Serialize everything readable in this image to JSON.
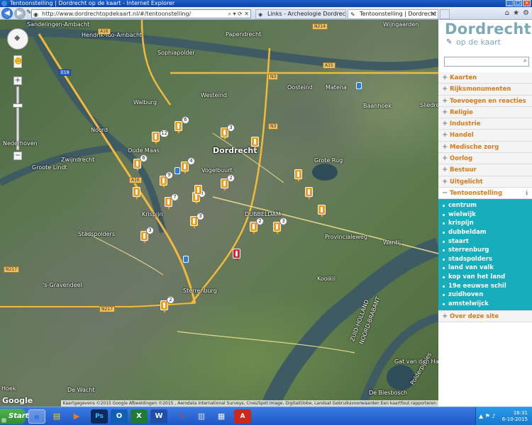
{
  "window": {
    "title": "Tentoonstelling | Dordrecht op de kaart - Internet Explorer"
  },
  "browser": {
    "url": "http://www.dordrechtopdekaart.nl/#/tentoonstelling/",
    "tabs": [
      {
        "label": "Links - Archeologie Dordrecht",
        "active": false
      },
      {
        "label": "Tentoonstelling | Dordrecht ...",
        "active": true
      }
    ]
  },
  "map": {
    "places": [
      {
        "label": "Sandelingen-Ambacht"
      },
      {
        "label": "Hendrik-Ido-Ambacht"
      },
      {
        "label": "Papendrecht"
      },
      {
        "label": "Sophiapolder"
      },
      {
        "label": "Walburg"
      },
      {
        "label": "Westeind"
      },
      {
        "label": "Oosteind"
      },
      {
        "label": "Matena"
      },
      {
        "label": "Baanhoek"
      },
      {
        "label": "Sliedrecht"
      },
      {
        "label": "Wijngaarden"
      },
      {
        "label": "Noord"
      },
      {
        "label": "Nederhoven"
      },
      {
        "label": "Zwijndrecht"
      },
      {
        "label": "Groote Lindt"
      },
      {
        "label": "Dordrecht"
      },
      {
        "label": "Vogelbuurt"
      },
      {
        "label": "Grote Rug"
      },
      {
        "label": "Oude Maas"
      },
      {
        "label": "Krispijn"
      },
      {
        "label": "DUBBELDAM"
      },
      {
        "label": "Provincialeweg"
      },
      {
        "label": "Wantij"
      },
      {
        "label": "Sterrenburg"
      },
      {
        "label": "'s-Gravendeel"
      },
      {
        "label": "De Wacht"
      },
      {
        "label": "Kooikil"
      },
      {
        "label": "ZUID-HOLLAND"
      },
      {
        "label": "NOORD-BRABANT"
      },
      {
        "label": "Gat van den Hardenhoek"
      },
      {
        "label": "De Biesbosch"
      },
      {
        "label": "Polderpijpjes"
      },
      {
        "label": "Hoek"
      },
      {
        "label": "Stadspolders"
      }
    ],
    "roads": [
      {
        "label": "A16"
      },
      {
        "label": "A15"
      },
      {
        "label": "N3"
      },
      {
        "label": "N214"
      },
      {
        "label": "N217"
      },
      {
        "label": "N217"
      },
      {
        "label": "E19"
      },
      {
        "label": "N3"
      },
      {
        "label": "A16"
      }
    ],
    "markers": [
      {
        "badge": "12"
      },
      {
        "badge": "6"
      },
      {
        "badge": "3"
      },
      {
        "badge": "4"
      },
      {
        "badge": "9"
      },
      {
        "badge": "6"
      },
      {
        "badge": "3"
      },
      {
        "badge": "2"
      },
      {
        "badge": "7"
      },
      {
        "badge": "3"
      },
      {
        "badge": "2"
      },
      {
        "badge": "3"
      },
      {
        "badge": "3"
      },
      {
        "badge": "2"
      },
      {
        "badge": ""
      },
      {
        "badge": ""
      },
      {
        "badge": ""
      },
      {
        "badge": ""
      },
      {
        "badge": ""
      },
      {
        "badge": ""
      }
    ],
    "red_marker": true,
    "google_logo": "Google",
    "attribution": "Kaartgegevens ©2015 Google Afbeeldingen ©2015 , Aerodata International Surveys, Cnes/Spot Image, DigitalGlobe, Landsat   Gebruiksvoorwaarden   Een kaartfout rapporteren"
  },
  "sidebar": {
    "logo_line1": "Dordrecht",
    "logo_line2": "op de kaart",
    "search_placeholder": "",
    "menu": [
      {
        "label": "Kaarten"
      },
      {
        "label": "Rijksmonumenten"
      },
      {
        "label": "Toevoegen en reacties"
      },
      {
        "label": "Religie"
      },
      {
        "label": "Industrie"
      },
      {
        "label": "Handel"
      },
      {
        "label": "Medische zorg"
      },
      {
        "label": "Oorlog"
      },
      {
        "label": "Bestuur"
      },
      {
        "label": "Uitgelicht"
      },
      {
        "label": "Tentoonstelling"
      }
    ],
    "submenu": [
      "centrum",
      "wielwijk",
      "krispijn",
      "dubbeldam",
      "staart",
      "sterrenburg",
      "stadspolders",
      "land van valk",
      "kop van het land",
      "19e eeuwse schil",
      "zuidhoven",
      "amstelwijck"
    ],
    "about": "Over deze site"
  },
  "taskbar": {
    "start_label": "Start",
    "time": "16:31",
    "date": "6-10-2015"
  }
}
